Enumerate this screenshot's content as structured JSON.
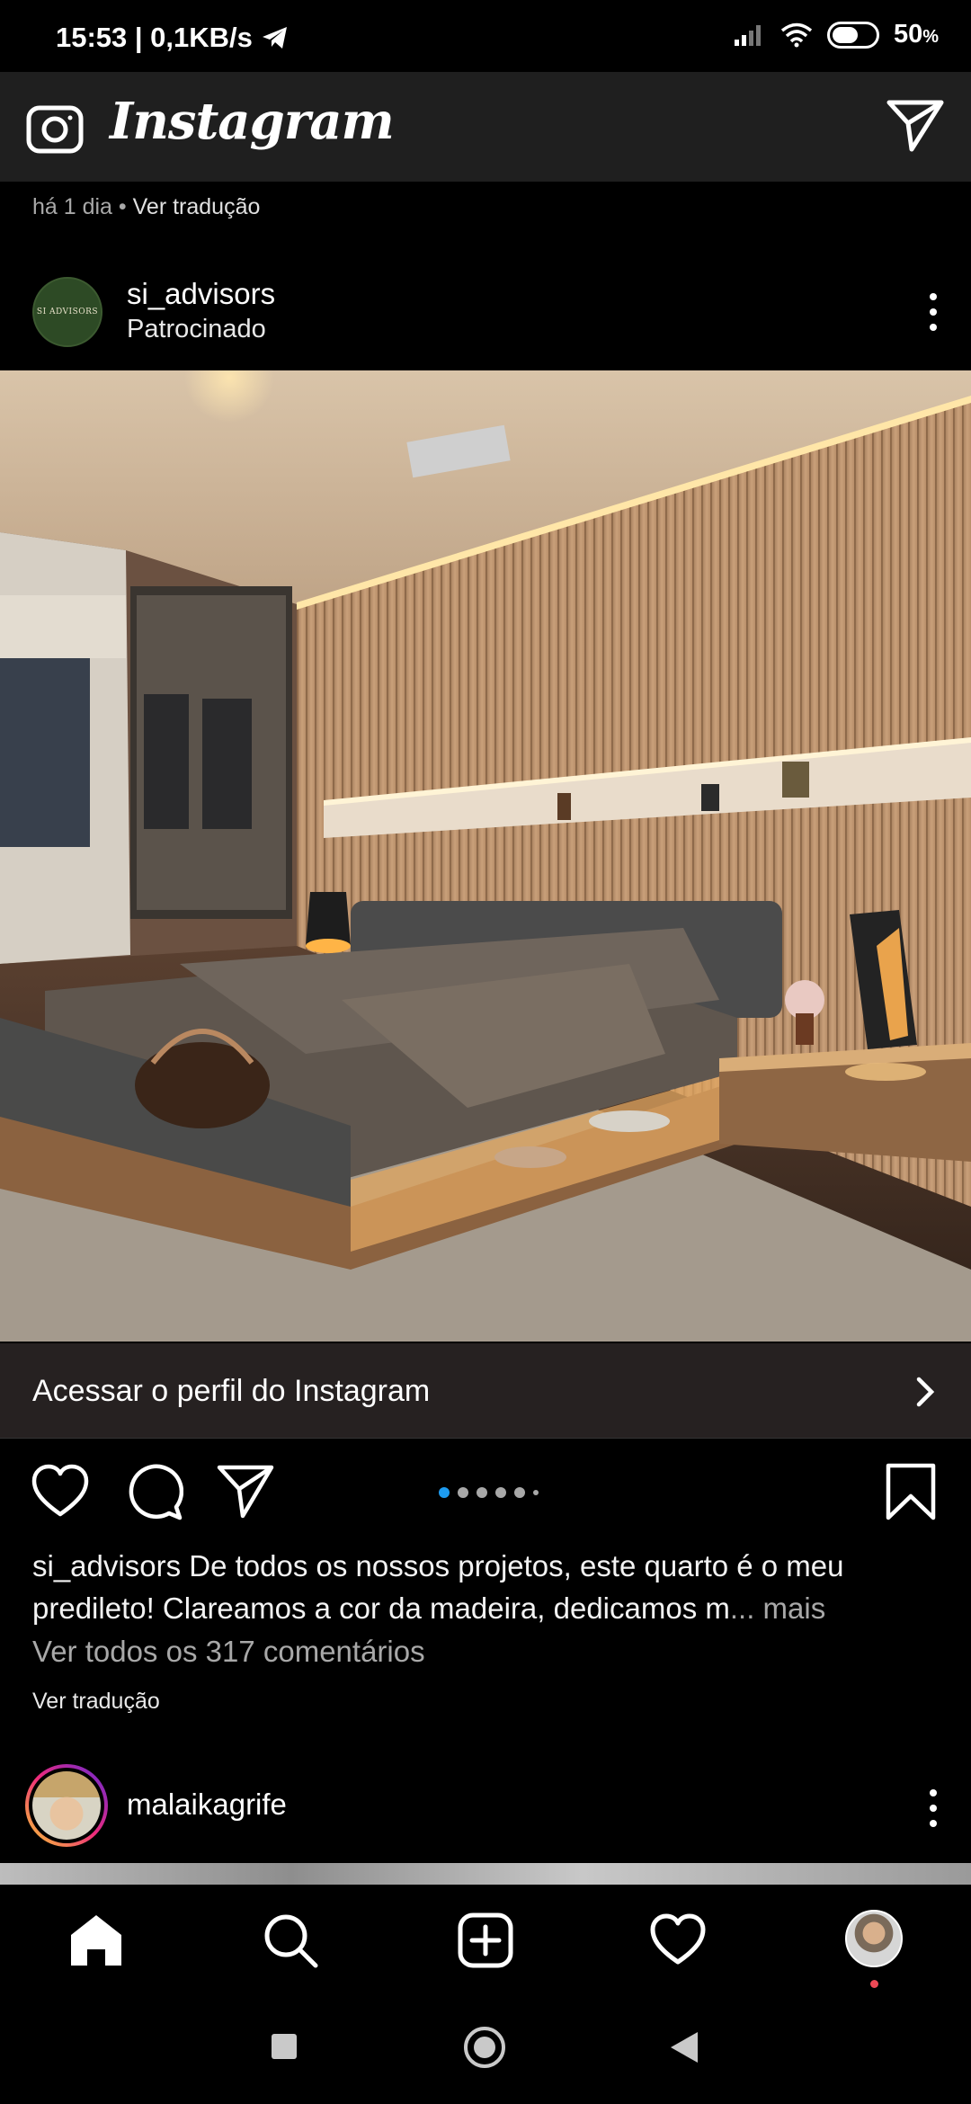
{
  "status_bar": {
    "time_speed": "15:53 | 0,1KB/s",
    "battery": "50",
    "battery_unit": "%"
  },
  "app_bar": {
    "logo": "Instagram",
    "camera_icon": "camera-icon",
    "dm_icon": "paper-plane-icon"
  },
  "previous_post": {
    "age": "há 1 dia",
    "separator": " • ",
    "translate": "Ver tradução"
  },
  "post": {
    "username": "si_advisors",
    "sponsored": "Patrocinado",
    "avatar_text": "SI ADVISORS",
    "cta_label": "Acessar o perfil do Instagram",
    "carousel": {
      "count": 6,
      "active_index": 0
    },
    "caption_user": "si_advisors",
    "caption_text": " De todos os nossos projetos, este quarto é o meu predileto! Clareamos a cor da madeira, dedicamos m",
    "caption_more": "... mais",
    "comments_link": "Ver todos os 317 comentários",
    "translate": "Ver tradução"
  },
  "next_post": {
    "username": "malaikagrife"
  },
  "bottom_nav": {
    "items": [
      "home-icon",
      "search-icon",
      "new-post-icon",
      "activity-heart-icon",
      "profile-avatar"
    ]
  },
  "colors": {
    "background": "#000000",
    "app_bar": "#1f1f1f",
    "cta_bg": "#262121",
    "accent_blue": "#1d9bf0",
    "notification_red": "#ed4956"
  }
}
